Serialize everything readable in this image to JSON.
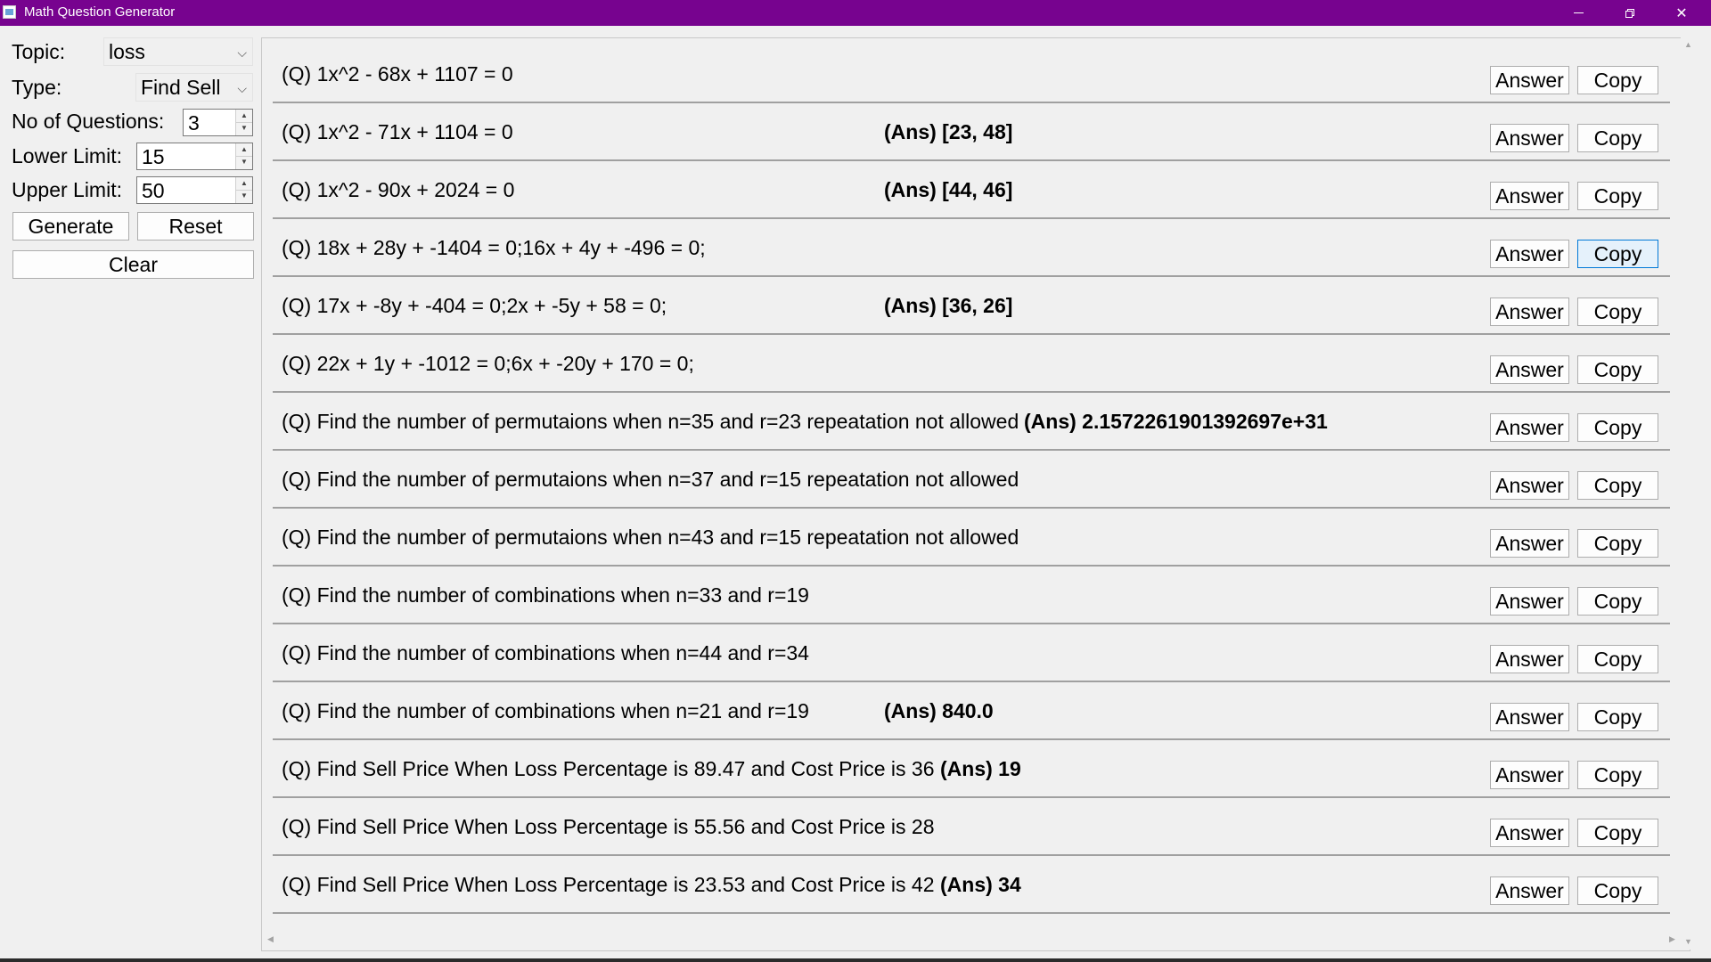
{
  "window": {
    "title": "Math Question Generator"
  },
  "controls": {
    "topic_label": "Topic:",
    "topic_value": "loss",
    "type_label": "Type:",
    "type_value": "Find Sell",
    "num_questions_label": "No of Questions:",
    "num_questions_value": "3",
    "lower_limit_label": "Lower Limit:",
    "lower_limit_value": "15",
    "upper_limit_label": "Upper Limit:",
    "upper_limit_value": "50",
    "generate_label": "Generate",
    "reset_label": "Reset",
    "clear_label": "Clear"
  },
  "questions": [
    {
      "q": "(Q) 1x^2 - 68x + 1107 = 0",
      "ans": ""
    },
    {
      "q": "(Q) 1x^2 - 71x + 1104 = 0",
      "ans": "(Ans) [23, 48]"
    },
    {
      "q": "(Q) 1x^2 - 90x + 2024 = 0",
      "ans": "(Ans) [44, 46]"
    },
    {
      "q": "(Q) 18x + 28y + -1404 = 0;16x + 4y + -496 = 0;",
      "ans": ""
    },
    {
      "q": "(Q) 17x + -8y + -404 = 0;2x + -5y + 58 = 0;",
      "ans": "(Ans) [36, 26]"
    },
    {
      "q": "(Q) 22x + 1y + -1012 = 0;6x + -20y + 170 = 0;",
      "ans": ""
    },
    {
      "q": "(Q) Find the number of permutaions when n=35 and r=23 repeatation not allowed",
      "ans": "(Ans) 2.1572261901392697e+31"
    },
    {
      "q": "(Q) Find the number of permutaions when n=37 and r=15 repeatation not allowed",
      "ans": ""
    },
    {
      "q": "(Q) Find the number of permutaions when n=43 and r=15 repeatation not allowed",
      "ans": ""
    },
    {
      "q": "(Q) Find the number of combinations when n=33 and r=19",
      "ans": ""
    },
    {
      "q": "(Q) Find the number of combinations when n=44 and r=34",
      "ans": ""
    },
    {
      "q": "(Q) Find the number of combinations when n=21 and r=19",
      "ans": "(Ans) 840.0"
    },
    {
      "q": "(Q) Find Sell Price When Loss Percentage is 89.47 and Cost Price is 36",
      "ans": "(Ans) 19"
    },
    {
      "q": "(Q) Find Sell Price When Loss Percentage is 55.56 and Cost Price is 28",
      "ans": ""
    },
    {
      "q": "(Q) Find Sell Price When Loss Percentage is 23.53 and Cost Price is 42",
      "ans": "(Ans) 34"
    }
  ],
  "row_buttons": {
    "answer_label": "Answer",
    "copy_label": "Copy"
  }
}
